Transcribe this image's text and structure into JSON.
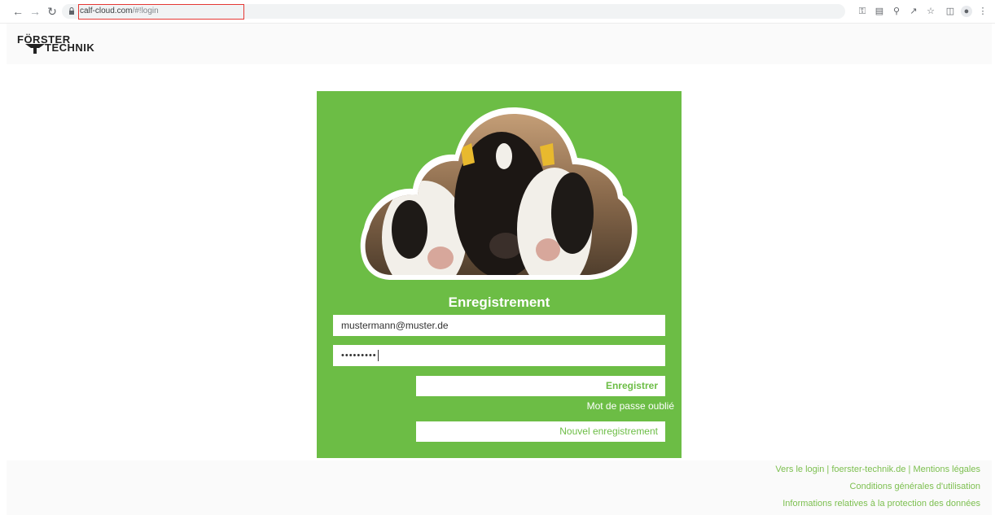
{
  "browser": {
    "url_host": "calf-cloud.com",
    "url_path": "/#!login"
  },
  "header": {
    "logo_line1": "FÖRSTER",
    "logo_line2": "TECHNIK"
  },
  "login": {
    "title": "Enregistrement",
    "email_value": "mustermann@muster.de",
    "password_value": "•••••••••",
    "submit_label": "Enregistrer",
    "forgot_label": "Mot de passe oublié",
    "register_label": "Nouvel enregistrement"
  },
  "footer": {
    "link_login": "Vers le login",
    "link_site": "foerster-technik.de",
    "link_legal": "Mentions légales",
    "separator": "|",
    "link_terms": "Conditions générales d'utilisation",
    "link_privacy": "Informations relatives à la protection des données"
  },
  "colors": {
    "brand_green": "#6cbd45",
    "link_green": "#7cbf4f",
    "url_highlight": "#e53935"
  },
  "icons": [
    "back-icon",
    "forward-icon",
    "reload-icon",
    "lock-icon",
    "key-icon",
    "translate-icon",
    "zoom-icon",
    "share-icon",
    "star-icon",
    "sidepanel-icon",
    "profile-icon",
    "menu-icon"
  ]
}
